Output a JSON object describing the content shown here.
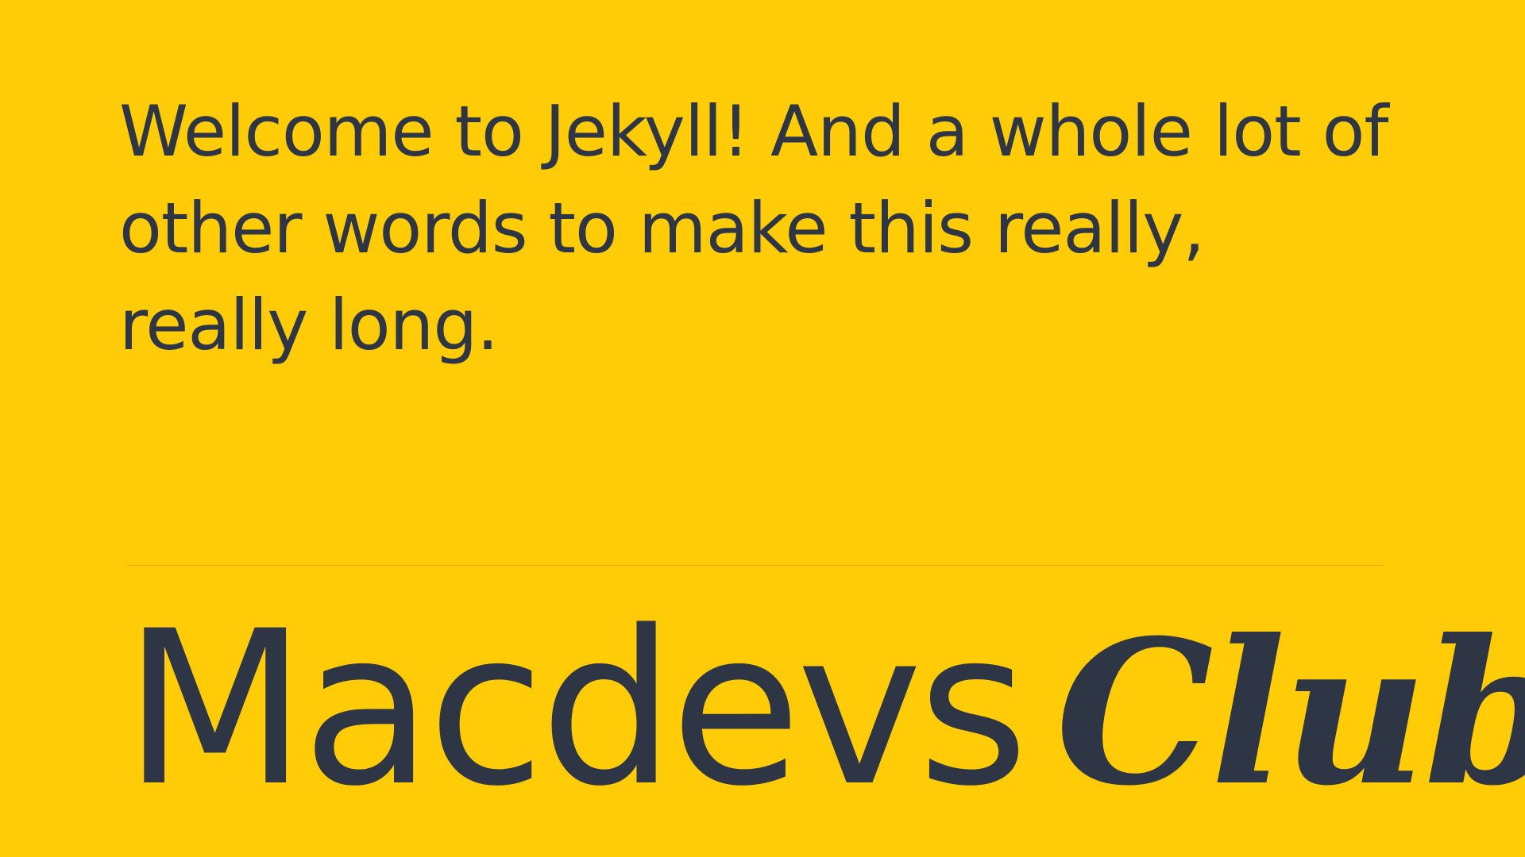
{
  "page": {
    "headline": "Welcome to Jekyll! And a whole lot of other words to make this really, really long."
  },
  "brand": {
    "name_main": "Macdevs",
    "name_script": "Club"
  },
  "colors": {
    "background": "#FFCC07",
    "text": "#2E3544"
  }
}
